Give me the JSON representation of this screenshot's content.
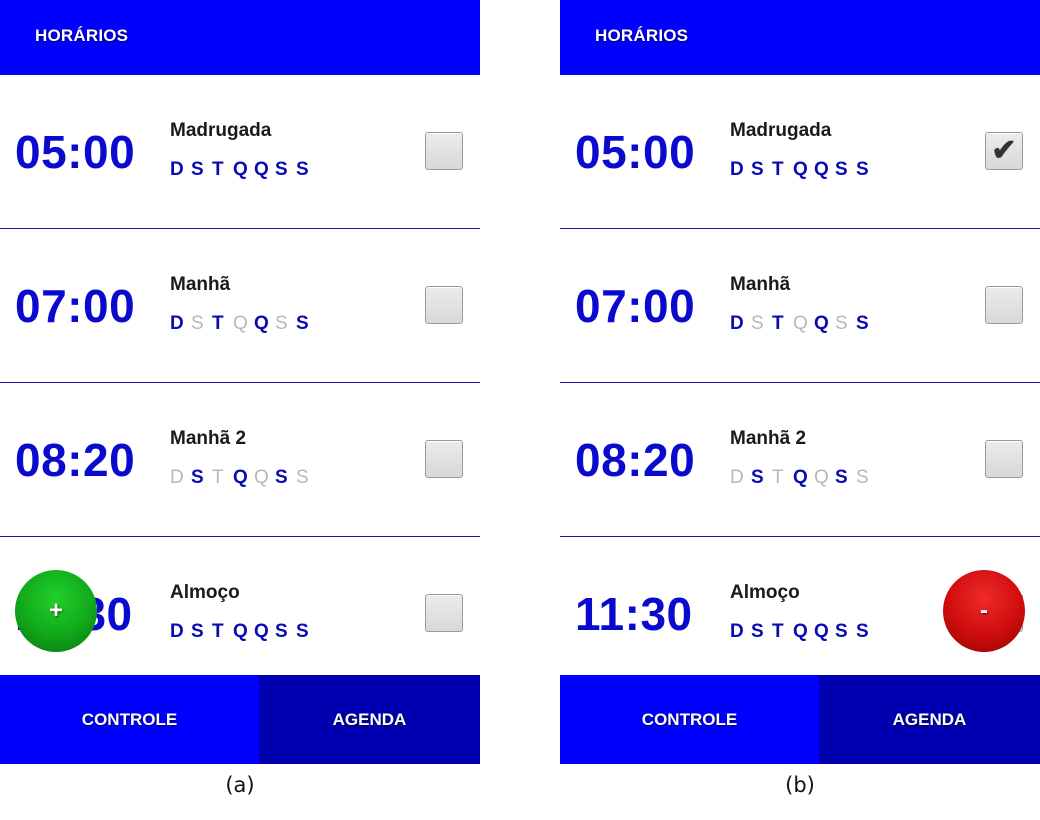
{
  "colors": {
    "header": "#0000ff",
    "tab_active": "#0000ff",
    "tab_inactive": "#0000b0",
    "time": "#0a0acf",
    "day_on": "#0a0ab5",
    "day_off": "#b8b8b8",
    "add_fab": "#10a81a",
    "remove_fab": "#cf0c0c"
  },
  "panels": [
    {
      "caption": "(a)",
      "header_title": "HORÁRIOS",
      "rows": [
        {
          "time": "05:00",
          "label": "Madrugada",
          "checked": false,
          "days": [
            {
              "letter": "D",
              "on": true
            },
            {
              "letter": "S",
              "on": true
            },
            {
              "letter": "T",
              "on": true
            },
            {
              "letter": "Q",
              "on": true
            },
            {
              "letter": "Q",
              "on": true
            },
            {
              "letter": "S",
              "on": true
            },
            {
              "letter": "S",
              "on": true
            }
          ]
        },
        {
          "time": "07:00",
          "label": "Manhã",
          "checked": false,
          "days": [
            {
              "letter": "D",
              "on": true
            },
            {
              "letter": "S",
              "on": false
            },
            {
              "letter": "T",
              "on": true
            },
            {
              "letter": "Q",
              "on": false
            },
            {
              "letter": "Q",
              "on": true
            },
            {
              "letter": "S",
              "on": false
            },
            {
              "letter": "S",
              "on": true
            }
          ]
        },
        {
          "time": "08:20",
          "label": "Manhã 2",
          "checked": false,
          "days": [
            {
              "letter": "D",
              "on": false
            },
            {
              "letter": "S",
              "on": true
            },
            {
              "letter": "T",
              "on": false
            },
            {
              "letter": "Q",
              "on": true
            },
            {
              "letter": "Q",
              "on": false
            },
            {
              "letter": "S",
              "on": true
            },
            {
              "letter": "S",
              "on": false
            }
          ]
        },
        {
          "time": "11:30",
          "label": "Almoço",
          "checked": false,
          "days": [
            {
              "letter": "D",
              "on": true
            },
            {
              "letter": "S",
              "on": true
            },
            {
              "letter": "T",
              "on": true
            },
            {
              "letter": "Q",
              "on": true
            },
            {
              "letter": "Q",
              "on": true
            },
            {
              "letter": "S",
              "on": true
            },
            {
              "letter": "S",
              "on": true
            }
          ]
        }
      ],
      "fab": {
        "kind": "add",
        "label": "+",
        "icon": "plus-icon"
      },
      "tabs": {
        "controle": "CONTROLE",
        "agenda": "AGENDA"
      }
    },
    {
      "caption": "(b)",
      "header_title": "HORÁRIOS",
      "rows": [
        {
          "time": "05:00",
          "label": "Madrugada",
          "checked": true,
          "days": [
            {
              "letter": "D",
              "on": true
            },
            {
              "letter": "S",
              "on": true
            },
            {
              "letter": "T",
              "on": true
            },
            {
              "letter": "Q",
              "on": true
            },
            {
              "letter": "Q",
              "on": true
            },
            {
              "letter": "S",
              "on": true
            },
            {
              "letter": "S",
              "on": true
            }
          ]
        },
        {
          "time": "07:00",
          "label": "Manhã",
          "checked": false,
          "days": [
            {
              "letter": "D",
              "on": true
            },
            {
              "letter": "S",
              "on": false
            },
            {
              "letter": "T",
              "on": true
            },
            {
              "letter": "Q",
              "on": false
            },
            {
              "letter": "Q",
              "on": true
            },
            {
              "letter": "S",
              "on": false
            },
            {
              "letter": "S",
              "on": true
            }
          ]
        },
        {
          "time": "08:20",
          "label": "Manhã 2",
          "checked": false,
          "days": [
            {
              "letter": "D",
              "on": false
            },
            {
              "letter": "S",
              "on": true
            },
            {
              "letter": "T",
              "on": false
            },
            {
              "letter": "Q",
              "on": true
            },
            {
              "letter": "Q",
              "on": false
            },
            {
              "letter": "S",
              "on": true
            },
            {
              "letter": "S",
              "on": false
            }
          ]
        },
        {
          "time": "11:30",
          "label": "Almoço",
          "checked": false,
          "days": [
            {
              "letter": "D",
              "on": true
            },
            {
              "letter": "S",
              "on": true
            },
            {
              "letter": "T",
              "on": true
            },
            {
              "letter": "Q",
              "on": true
            },
            {
              "letter": "Q",
              "on": true
            },
            {
              "letter": "S",
              "on": true
            },
            {
              "letter": "S",
              "on": true
            }
          ]
        }
      ],
      "fab": {
        "kind": "remove",
        "label": "-",
        "icon": "minus-icon"
      },
      "tabs": {
        "controle": "CONTROLE",
        "agenda": "AGENDA"
      }
    }
  ],
  "check_icon": "checkmark-icon",
  "check_glyph": "✔"
}
